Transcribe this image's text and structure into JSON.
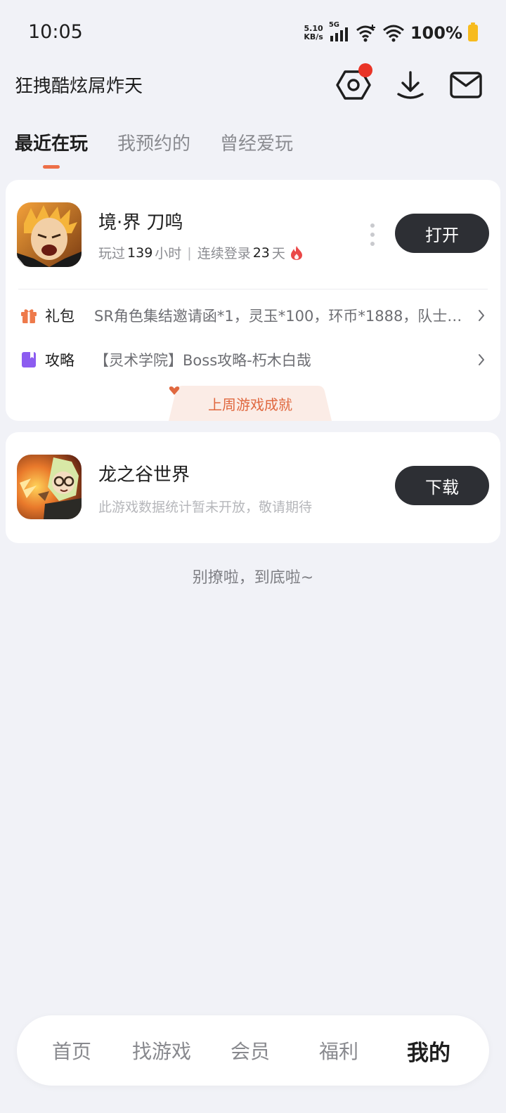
{
  "status_bar": {
    "time": "10:05",
    "net_speed_value": "5.10",
    "net_speed_unit": "KB/s",
    "network_type": "5G",
    "battery_percent": "100%",
    "battery_color": "#f7bb1e"
  },
  "header": {
    "username": "狂拽酷炫屌炸天",
    "icons": [
      "settings-icon",
      "download-icon",
      "mail-icon"
    ],
    "notification_dot_color": "#e93427"
  },
  "tabs": [
    {
      "label": "最近在玩",
      "active": true
    },
    {
      "label": "我预约的",
      "active": false
    },
    {
      "label": "曾经爱玩",
      "active": false
    }
  ],
  "games": [
    {
      "name": "境·界 刀鸣",
      "stats_prefix": "玩过",
      "hours": "139",
      "hours_unit": "小时",
      "separator": "|",
      "streak_prefix": "连续登录",
      "streak_days": "23",
      "streak_unit": "天",
      "action_label": "打开",
      "gift_label": "礼包",
      "gift_text": "SR角色集结邀请函*1，灵玉*100，环币*1888，队士…",
      "guide_label": "攻略",
      "guide_text": "【灵术学院】Boss攻略-朽木白哉",
      "achievement_label": "上周游戏成就"
    },
    {
      "name": "龙之谷世界",
      "description": "此游戏数据统计暂未开放，敬请期待",
      "action_label": "下载"
    }
  ],
  "end_text": "别撩啦，到底啦~",
  "bottom_nav": [
    {
      "label": "首页",
      "active": false
    },
    {
      "label": "找游戏",
      "active": false
    },
    {
      "label": "会员",
      "active": false
    },
    {
      "label": "福利",
      "active": false
    },
    {
      "label": "我的",
      "active": true
    }
  ],
  "colors": {
    "accent": "#ed6f48",
    "button_dark": "#2d2f34",
    "page_bg": "#f1f2f7",
    "gift_icon": "#ee7a4b",
    "guide_icon": "#8c5cf0"
  }
}
